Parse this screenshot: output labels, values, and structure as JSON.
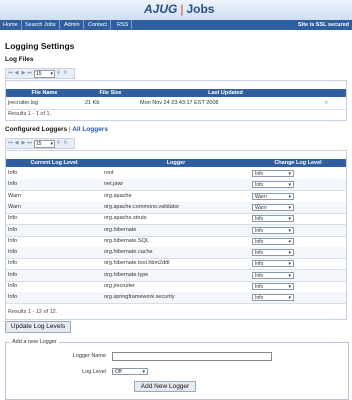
{
  "header": {
    "logo_left": "AJUG",
    "logo_sep": "|",
    "logo_right": "Jobs"
  },
  "nav": {
    "items": [
      "Home",
      "Search Jobs",
      "Admin",
      "Contact",
      "RSS"
    ],
    "ssl": "Site is SSL secured"
  },
  "page_title": "Logging Settings",
  "log_files": {
    "heading": "Log Files",
    "page_size": "15",
    "columns": [
      "File Name",
      "File Size",
      "Last Updated"
    ],
    "rows": [
      {
        "name": "jrecruiter.log",
        "size": "21 Kb",
        "updated": "Mon Nov 24 23:43:17 EST 2008"
      }
    ],
    "results": "Results 1 - 1 of 1."
  },
  "loggers": {
    "heading": "Configured Loggers",
    "separator": "|",
    "all_link": "All Loggers",
    "page_size": "15",
    "columns": [
      "Current Log Level",
      "Logger",
      "Change Log Level"
    ],
    "rows": [
      {
        "level": "Info",
        "name": "root",
        "select": "Info"
      },
      {
        "level": "Info",
        "name": "net.jawr",
        "select": "Info"
      },
      {
        "level": "Warn",
        "name": "org.apache",
        "select": "Warn"
      },
      {
        "level": "Warn",
        "name": "org.apache.commons.validator",
        "select": "Warn"
      },
      {
        "level": "Info",
        "name": "org.apache.struts",
        "select": "Info"
      },
      {
        "level": "Info",
        "name": "org.hibernate",
        "select": "Info"
      },
      {
        "level": "Info",
        "name": "org.hibernate.SQL",
        "select": "Info"
      },
      {
        "level": "Info",
        "name": "org.hibernate.cache",
        "select": "Info"
      },
      {
        "level": "Info",
        "name": "org.hibernate.tool.hbm2ddl",
        "select": "Info"
      },
      {
        "level": "Info",
        "name": "org.hibernate.type",
        "select": "Info"
      },
      {
        "level": "Info",
        "name": "org.jrecruiter",
        "select": "Info"
      },
      {
        "level": "Info",
        "name": "org.springframework.security",
        "select": "Info"
      }
    ],
    "results": "Results 1 - 12 of 12.",
    "update_button": "Update Log Levels"
  },
  "add_logger": {
    "legend": "Add a new Logger",
    "name_label": "Logger Name",
    "level_label": "Log Level",
    "level_value": "Off",
    "submit": "Add New Logger"
  }
}
